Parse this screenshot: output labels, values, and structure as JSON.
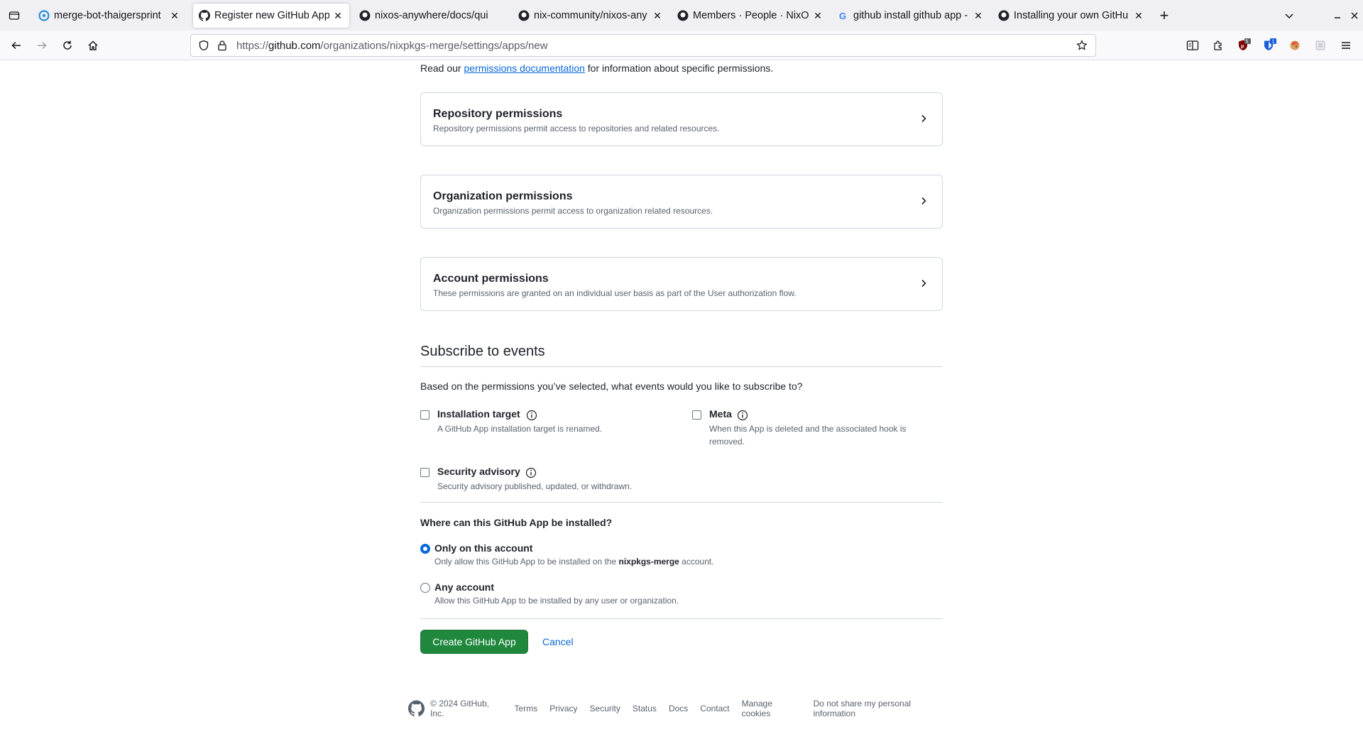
{
  "browser": {
    "tabs": [
      {
        "title": "merge-bot-thaigersprint",
        "icon": "buildbot-icon"
      },
      {
        "title": "Register new GitHub App",
        "icon": "github-icon",
        "active": true
      },
      {
        "title": "nixos-anywhere/docs/qui",
        "icon": "github-icon"
      },
      {
        "title": "nix-community/nixos-any",
        "icon": "github-icon"
      },
      {
        "title": "Members · People · NixOS",
        "icon": "github-icon"
      },
      {
        "title": "github install github app -",
        "icon": "google-icon"
      },
      {
        "title": "Installing your own GitHu",
        "icon": "github-icon"
      }
    ],
    "url_prefix": "https://",
    "url_host": "github.com",
    "url_path": "/organizations/nixpkgs-merge/settings/apps/new",
    "badges": {
      "ublock": "5",
      "bitwarden": "1"
    }
  },
  "page": {
    "intro_before": "Read our ",
    "intro_link": "permissions documentation",
    "intro_after": " for information about specific permissions.",
    "permissions": [
      {
        "title": "Repository permissions",
        "desc": "Repository permissions permit access to repositories and related resources."
      },
      {
        "title": "Organization permissions",
        "desc": "Organization permissions permit access to organization related resources."
      },
      {
        "title": "Account permissions",
        "desc": "These permissions are granted on an individual user basis as part of the User authorization flow."
      }
    ],
    "subscribe_title": "Subscribe to events",
    "subscribe_question": "Based on the permissions you’ve selected, what events would you like to subscribe to?",
    "events": [
      {
        "label": "Installation target",
        "desc": "A GitHub App installation target is renamed."
      },
      {
        "label": "Meta",
        "desc": "When this App is deleted and the associated hook is removed."
      },
      {
        "label": "Security advisory",
        "desc": "Security advisory published, updated, or withdrawn."
      }
    ],
    "where_question": "Where can this GitHub App be installed?",
    "install_options": [
      {
        "label": "Only on this account",
        "desc_before": "Only allow this GitHub App to be installed on the ",
        "desc_bold": "nixpkgs-merge",
        "desc_after": " account.",
        "checked": true
      },
      {
        "label": "Any account",
        "desc": "Allow this GitHub App to be installed by any user or organization.",
        "checked": false
      }
    ],
    "create_button": "Create GitHub App",
    "cancel_link": "Cancel"
  },
  "footer": {
    "copyright": "© 2024 GitHub, Inc.",
    "links": [
      "Terms",
      "Privacy",
      "Security",
      "Status",
      "Docs",
      "Contact",
      "Manage cookies",
      "Do not share my personal information"
    ]
  },
  "colors": {
    "primary_button": "#1f883d",
    "link": "#0969da",
    "border": "#d0d7de",
    "muted_text": "#59636e"
  }
}
